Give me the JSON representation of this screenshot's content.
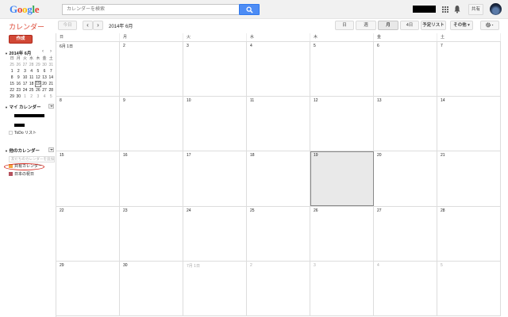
{
  "header": {
    "logo": {
      "letters": [
        "G",
        "o",
        "o",
        "g",
        "l",
        "e"
      ]
    },
    "search": {
      "placeholder": "カレンダーを検索"
    },
    "share_label": "共有"
  },
  "toolbar": {
    "app_title": "カレンダー",
    "today_label": "今日",
    "prev": "‹",
    "next": "›",
    "current_period": "2014年 6月",
    "views": [
      "日",
      "週",
      "月",
      "4日",
      "予定リスト"
    ],
    "active_view": "月",
    "more_label": "その他 ▾",
    "settings_icon": "gear-icon"
  },
  "sidebar": {
    "create_label": "作成",
    "mini_calendar": {
      "title": "2014年 6月",
      "weekdays": [
        "日",
        "月",
        "火",
        "水",
        "木",
        "金",
        "土"
      ],
      "weeks": [
        [
          "25",
          "26",
          "27",
          "28",
          "29",
          "30",
          "31"
        ],
        [
          "1",
          "2",
          "3",
          "4",
          "5",
          "6",
          "7"
        ],
        [
          "8",
          "9",
          "10",
          "11",
          "12",
          "13",
          "14"
        ],
        [
          "15",
          "16",
          "17",
          "18",
          "19",
          "20",
          "21"
        ],
        [
          "22",
          "23",
          "24",
          "25",
          "26",
          "27",
          "28"
        ],
        [
          "29",
          "30",
          "1",
          "2",
          "3",
          "4",
          "5"
        ]
      ],
      "today": "19"
    },
    "my_calendars_title": "マイ カレンダー",
    "my_calendars_todo": "ToDo リスト",
    "other_calendars_title": "他のカレンダー",
    "add_friend_placeholder": "友だちのカレンダーを追加",
    "other_calendars": [
      {
        "label": "共有カレンダー",
        "color": "#f2a640"
      },
      {
        "label": "日本の祝日",
        "color": "#b5515d"
      }
    ]
  },
  "month_view": {
    "weekdays": [
      "日",
      "月",
      "火",
      "水",
      "木",
      "金",
      "土"
    ],
    "weeks": [
      [
        {
          "d": "6月 1日"
        },
        {
          "d": "2"
        },
        {
          "d": "3"
        },
        {
          "d": "4"
        },
        {
          "d": "5"
        },
        {
          "d": "6"
        },
        {
          "d": "7"
        }
      ],
      [
        {
          "d": "8"
        },
        {
          "d": "9"
        },
        {
          "d": "10"
        },
        {
          "d": "11"
        },
        {
          "d": "12"
        },
        {
          "d": "13"
        },
        {
          "d": "14"
        }
      ],
      [
        {
          "d": "15"
        },
        {
          "d": "16"
        },
        {
          "d": "17"
        },
        {
          "d": "18"
        },
        {
          "d": "19",
          "today": true
        },
        {
          "d": "20"
        },
        {
          "d": "21"
        }
      ],
      [
        {
          "d": "22"
        },
        {
          "d": "23"
        },
        {
          "d": "24"
        },
        {
          "d": "25"
        },
        {
          "d": "26"
        },
        {
          "d": "27"
        },
        {
          "d": "28"
        }
      ],
      [
        {
          "d": "29"
        },
        {
          "d": "30"
        },
        {
          "d": "7月 1日",
          "other": true
        },
        {
          "d": "2",
          "other": true
        },
        {
          "d": "3",
          "other": true
        },
        {
          "d": "4",
          "other": true
        },
        {
          "d": "5",
          "other": true
        }
      ]
    ]
  }
}
